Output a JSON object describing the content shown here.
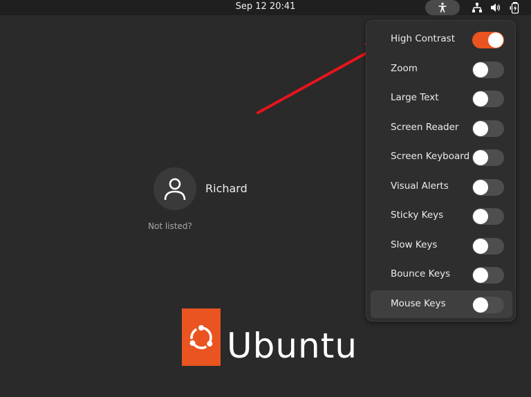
{
  "topbar": {
    "datetime": "Sep 12  20:41",
    "icons": [
      "accessibility-icon",
      "network-icon",
      "volume-icon",
      "battery-icon"
    ]
  },
  "accessibility_menu": {
    "items": [
      {
        "label": "High Contrast",
        "enabled": true
      },
      {
        "label": "Zoom",
        "enabled": false
      },
      {
        "label": "Large Text",
        "enabled": false
      },
      {
        "label": "Screen Reader",
        "enabled": false
      },
      {
        "label": "Screen Keyboard",
        "enabled": false
      },
      {
        "label": "Visual Alerts",
        "enabled": false
      },
      {
        "label": "Sticky Keys",
        "enabled": false
      },
      {
        "label": "Slow Keys",
        "enabled": false
      },
      {
        "label": "Bounce Keys",
        "enabled": false
      },
      {
        "label": "Mouse Keys",
        "enabled": false,
        "hovered": true
      }
    ]
  },
  "login": {
    "username": "Richard",
    "not_listed": "Not listed?"
  },
  "branding": {
    "wordmark": "Ubuntu"
  },
  "colors": {
    "accent": "#e95420",
    "background": "#2a2a2a",
    "annotation_arrow": "#e8141c"
  }
}
